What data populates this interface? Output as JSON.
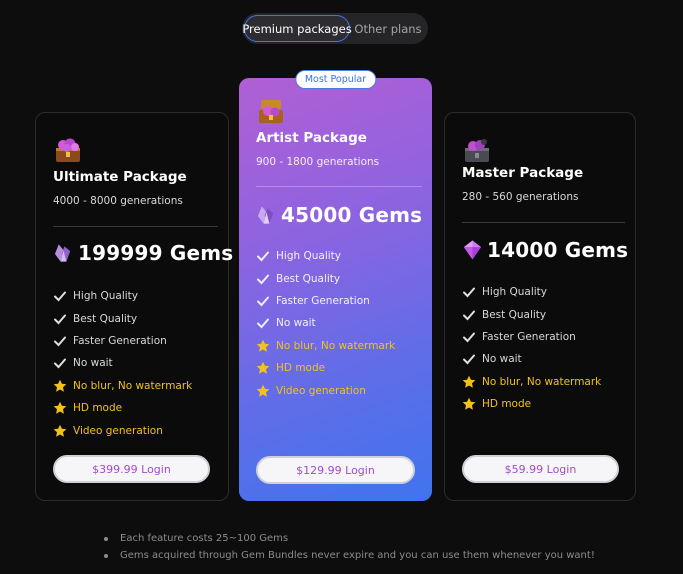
{
  "tabs": [
    {
      "label": "Premium packages",
      "active": true
    },
    {
      "label": "Other plans",
      "active": false
    }
  ],
  "packages": [
    {
      "title": "Ultimate Package",
      "generations": "4000 - 8000 generations",
      "gems": "199999 Gems",
      "icon": "treasure-chest-icon",
      "gem_icon": "gem-cluster-icon",
      "features": [
        {
          "label": "High Quality",
          "icon": "check-icon"
        },
        {
          "label": "Best Quality",
          "icon": "check-icon"
        },
        {
          "label": "Faster Generation",
          "icon": "check-icon"
        },
        {
          "label": "No wait",
          "icon": "check-icon"
        },
        {
          "label": "No blur, No watermark",
          "icon": "star-icon"
        },
        {
          "label": "HD mode",
          "icon": "star-icon"
        },
        {
          "label": "Video generation",
          "icon": "star-icon"
        }
      ],
      "cta": "$399.99 Login"
    },
    {
      "title": "Artist Package",
      "badge": "Most Popular",
      "generations": "900 - 1800 generations",
      "gems": "45000 Gems",
      "icon": "treasure-chest-icon",
      "gem_icon": "gem-cluster-icon",
      "features": [
        {
          "label": "High Quality",
          "icon": "check-icon"
        },
        {
          "label": "Best Quality",
          "icon": "check-icon"
        },
        {
          "label": "Faster Generation",
          "icon": "check-icon"
        },
        {
          "label": "No wait",
          "icon": "check-icon"
        },
        {
          "label": "No blur, No watermark",
          "icon": "star-icon"
        },
        {
          "label": "HD mode",
          "icon": "star-icon"
        },
        {
          "label": "Video generation",
          "icon": "star-icon"
        }
      ],
      "cta": "$129.99 Login"
    },
    {
      "title": "Master Package",
      "generations": "280 - 560 generations",
      "gems": "14000 Gems",
      "icon": "treasure-chest-icon",
      "gem_icon": "purple-gem-icon",
      "features": [
        {
          "label": "High Quality",
          "icon": "check-icon"
        },
        {
          "label": "Best Quality",
          "icon": "check-icon"
        },
        {
          "label": "Faster Generation",
          "icon": "check-icon"
        },
        {
          "label": "No wait",
          "icon": "check-icon"
        },
        {
          "label": "No blur, No watermark",
          "icon": "star-icon"
        },
        {
          "label": "HD mode",
          "icon": "star-icon"
        }
      ],
      "cta": "$59.99 Login"
    }
  ],
  "notes": [
    "Each feature costs 25~100 Gems",
    "Gems acquired through Gem Bundles never expire and you can use them whenever you want!"
  ],
  "colors": {
    "background": "#0d0d0e",
    "accent_blue": "#3d76e8",
    "star": "#f2c21b",
    "cta_text": "#a24ad1"
  }
}
